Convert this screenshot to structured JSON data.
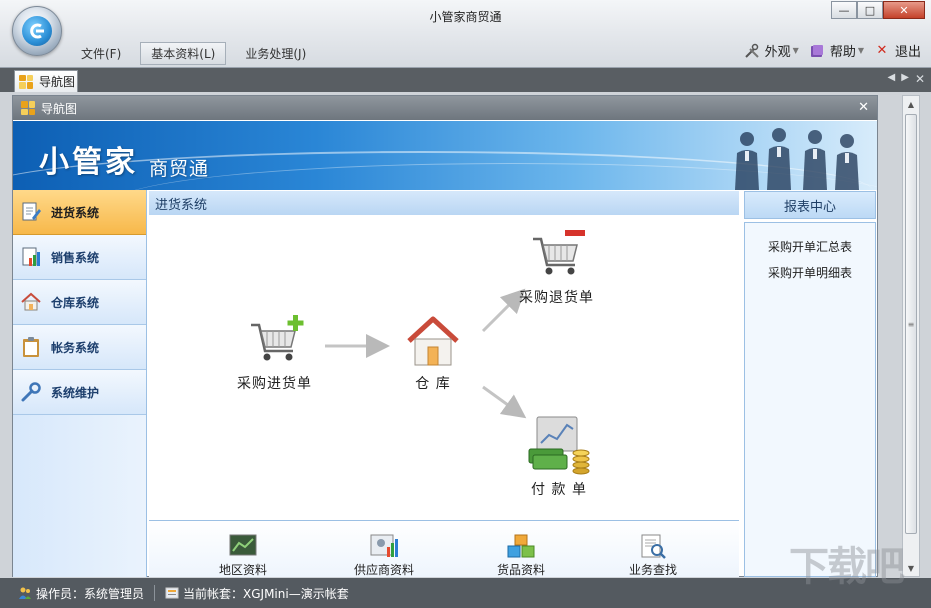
{
  "window": {
    "title": "小管家商贸通"
  },
  "menu": {
    "file": "文件(F)",
    "basic": "基本资料(L)",
    "business": "业务处理(J)"
  },
  "right_menu": {
    "appearance": "外观",
    "help": "帮助",
    "exit": "退出"
  },
  "tab": {
    "label": "导航图"
  },
  "inner_window": {
    "title": "导航图"
  },
  "banner": {
    "brand": "小管家",
    "sub": "商贸通"
  },
  "sidebar": {
    "items": [
      {
        "label": "进货系统",
        "icon": "document-edit-icon",
        "active": true
      },
      {
        "label": "销售系统",
        "icon": "sales-chart-icon"
      },
      {
        "label": "仓库系统",
        "icon": "house-icon"
      },
      {
        "label": "帐务系统",
        "icon": "clipboard-icon"
      },
      {
        "label": "系统维护",
        "icon": "wrench-icon"
      }
    ]
  },
  "panel": {
    "title": "进货系统"
  },
  "flow": {
    "purchase_in": "采购进货单",
    "warehouse": "仓 库",
    "purchase_return": "采购退货单",
    "payment": "付 款 单"
  },
  "bottom_items": [
    "地区资料",
    "供应商资料",
    "货品资料",
    "业务查找"
  ],
  "report": {
    "title": "报表中心",
    "links": [
      "采购开单汇总表",
      "采购开单明细表"
    ]
  },
  "status": {
    "operator": "操作员：系统管理员",
    "account": "当前帐套：XGJMini—演示帐套"
  },
  "watermark": "下载吧",
  "colors": {
    "accent_blue": "#2a86d6",
    "active_nav": "#f7b84a",
    "statusbar": "#545a60"
  }
}
